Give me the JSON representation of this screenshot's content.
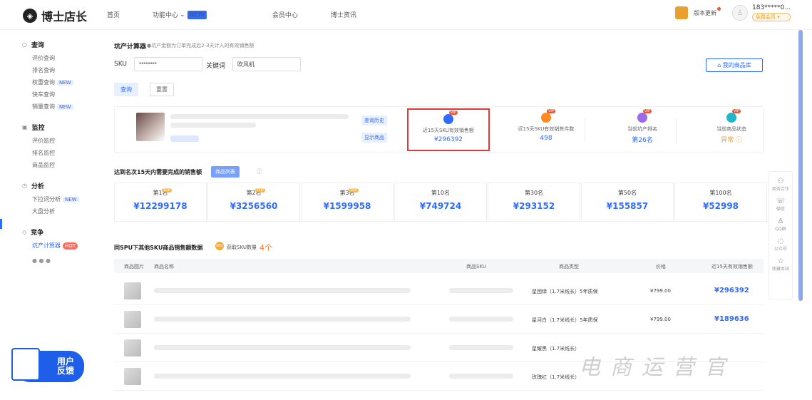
{
  "header": {
    "logo_mark": "◈",
    "logo": "博士店长",
    "nav": [
      "首页",
      "功能中心",
      "会员中心",
      "博士资讯"
    ],
    "nav_new": "NEW",
    "version": "版本更新",
    "user": "183*****0...",
    "user_level": "免费会员 ▾"
  },
  "sidebar": {
    "groups": [
      {
        "icon": "○",
        "title": "查询",
        "items": [
          {
            "label": "评价查询"
          },
          {
            "label": "排名查询"
          },
          {
            "label": "权重查询",
            "tag": "NEW"
          },
          {
            "label": "快车查询"
          },
          {
            "label": "销量查询",
            "tag": "NEW"
          }
        ]
      },
      {
        "icon": "▣",
        "title": "监控",
        "items": [
          {
            "label": "评价监控"
          },
          {
            "label": "排名监控"
          },
          {
            "label": "商品监控"
          }
        ]
      },
      {
        "icon": "◷",
        "title": "分析",
        "items": [
          {
            "label": "下拉词分析",
            "tag": "NEW"
          },
          {
            "label": "大盘分析"
          }
        ]
      },
      {
        "icon": "◇",
        "title": "竞争",
        "items": [
          {
            "label": "坑产计算器",
            "tag": "HOT",
            "active": true
          }
        ]
      }
    ],
    "more": "● ● ●",
    "feedback": "用户\n反馈"
  },
  "calc": {
    "title": "坑产计算器",
    "note": "●坑产金额为订单完成后2-3天计入的有效销售额",
    "sku_label": "SKU",
    "sku_value": "********",
    "kw_label": "关键词",
    "kw_value": "吹风机",
    "query": "查询",
    "reset": "重置",
    "lib": "⌂ 我的商品库"
  },
  "product": {
    "btn1": "查询历史",
    "btn2": "显示商品"
  },
  "metrics": [
    {
      "label": "近15天SKU有效销售额",
      "value": "¥296392",
      "color": "#2f6bff",
      "highlight": true
    },
    {
      "label": "近15天SKU有效销售件数",
      "value": "498",
      "color": "#ff8a1f"
    },
    {
      "label": "当前坑产排名",
      "value": "第26名",
      "color": "#9b6be8"
    },
    {
      "label": "当前商品状态",
      "value": "异常 ⓘ",
      "color": "#1fb8c8"
    }
  ],
  "metric_vip": "VIP",
  "rank_section": {
    "title": "达到名次15天内需要完成的销售额",
    "btn": "商品列表",
    "info": "ⓘ",
    "ranks": [
      {
        "label": "第1名",
        "value": "¥12299178",
        "top": "TOP"
      },
      {
        "label": "第2名",
        "value": "¥3256560",
        "top": "TOP"
      },
      {
        "label": "第3名",
        "value": "¥1599958",
        "top": "TOP"
      },
      {
        "label": "第10名",
        "value": "¥749724"
      },
      {
        "label": "第30名",
        "value": "¥293152"
      },
      {
        "label": "第50名",
        "value": "¥155857"
      },
      {
        "label": "第100名",
        "value": "¥52998"
      }
    ]
  },
  "spu": {
    "title": "同SPU下其他SKU商品销售额数据",
    "icon": "SKU",
    "sub": "获取SKU数量",
    "count": "4个",
    "headers": [
      "商品图片",
      "商品名称",
      "商品SKU",
      "商品类型",
      "价格",
      "近15天有效销售额"
    ],
    "rows": [
      {
        "type": "星团绿（1.7米线长）5年质保",
        "price": "¥799.00",
        "sales": "¥296392"
      },
      {
        "type": "星河白（1.7米线长）5年质保",
        "price": "¥799.00",
        "sales": "¥189636"
      },
      {
        "type": "星耀黑（1.7米线长）",
        "price": "",
        "sales": ""
      },
      {
        "type": "玫瑰红（1.7米线长）",
        "price": "",
        "sales": ""
      }
    ]
  },
  "rightbar": [
    {
      "g": "⚇",
      "label": "商务合作"
    },
    {
      "g": "☏",
      "label": "微信"
    },
    {
      "g": "♙",
      "label": "QQ群"
    },
    {
      "g": "◌",
      "label": "公众号"
    },
    {
      "g": "☆",
      "label": "收藏本站"
    }
  ],
  "watermark": "电商运营官"
}
